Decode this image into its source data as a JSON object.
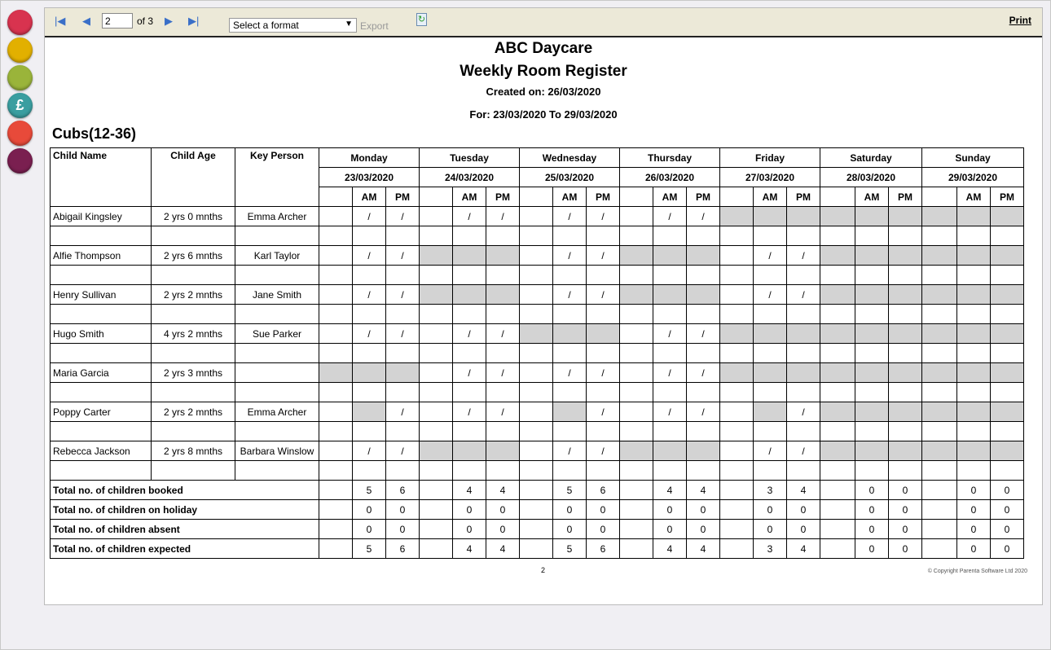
{
  "sidebar": {
    "items": [
      {
        "icon": "family-icon",
        "color": "#d8334f"
      },
      {
        "icon": "baby-icon",
        "color": "#e2b000"
      },
      {
        "icon": "register-icon",
        "color": "#9ab43a"
      },
      {
        "icon": "pound-icon",
        "color": "#3a9ea0",
        "glyph": "£"
      },
      {
        "icon": "parent-child-icon",
        "color": "#e84a3a"
      },
      {
        "icon": "wrench-icon",
        "color": "#7a1f50"
      }
    ]
  },
  "toolbar": {
    "page": "2",
    "of_label": "of 3",
    "format_placeholder": "Select a format",
    "export_label": "Export",
    "print_label": "Print"
  },
  "report": {
    "org": "ABC Daycare",
    "title": "Weekly Room Register",
    "created": "Created on: 26/03/2020",
    "range": "For: 23/03/2020 To 29/03/2020",
    "room": "Cubs(12-36)",
    "page_number": "2",
    "copyright": "© Copyright Parenta Software Ltd 2020"
  },
  "table": {
    "headers": {
      "name": "Child Name",
      "age": "Child Age",
      "key": "Key Person",
      "am": "AM",
      "pm": "PM"
    },
    "days": [
      {
        "day": "Monday",
        "date": "23/03/2020"
      },
      {
        "day": "Tuesday",
        "date": "24/03/2020"
      },
      {
        "day": "Wednesday",
        "date": "25/03/2020"
      },
      {
        "day": "Thursday",
        "date": "26/03/2020"
      },
      {
        "day": "Friday",
        "date": "27/03/2020"
      },
      {
        "day": "Saturday",
        "date": "28/03/2020"
      },
      {
        "day": "Sunday",
        "date": "29/03/2020"
      }
    ],
    "children": [
      {
        "name": "Abigail Kingsley",
        "age": "2 yrs 0 mnths",
        "key": "Emma Archer",
        "cells": [
          ".//",
          ".//",
          ".//",
          ".//",
          "ggg",
          "ggg",
          "ggg"
        ]
      },
      {
        "name": "Alfie Thompson",
        "age": "2 yrs 6 mnths",
        "key": "Karl Taylor",
        "cells": [
          ".//",
          "ggg",
          ".//",
          "ggg",
          ".//",
          "ggg",
          "ggg"
        ]
      },
      {
        "name": "Henry Sullivan",
        "age": "2 yrs 2 mnths",
        "key": "Jane Smith",
        "cells": [
          ".//",
          "ggg",
          ".//",
          "ggg",
          ".//",
          "ggg",
          "ggg"
        ]
      },
      {
        "name": "Hugo Smith",
        "age": "4 yrs 2 mnths",
        "key": "Sue Parker",
        "cells": [
          ".//",
          ".//",
          "ggg",
          ".//",
          "ggg",
          "ggg",
          "ggg"
        ]
      },
      {
        "name": "Maria Garcia",
        "age": "2 yrs 3 mnths",
        "key": "",
        "cells": [
          "ggg",
          ".//",
          ".//",
          ".//",
          "ggg",
          "ggg",
          "ggg"
        ]
      },
      {
        "name": "Poppy Carter",
        "age": "2 yrs 2 mnths",
        "key": "Emma Archer",
        "cells": [
          ".g/",
          ".//",
          ".g/",
          ".//",
          ".g/",
          "ggg",
          "ggg"
        ]
      },
      {
        "name": "Rebecca Jackson",
        "age": "2 yrs 8 mnths",
        "key": "Barbara Winslow",
        "cells": [
          ".//",
          "ggg",
          ".//",
          "ggg",
          ".//",
          "ggg",
          "ggg"
        ]
      }
    ],
    "mark": "/",
    "totals": [
      {
        "label": "Total no. of children booked",
        "values": [
          [
            5,
            6
          ],
          [
            4,
            4
          ],
          [
            5,
            6
          ],
          [
            4,
            4
          ],
          [
            3,
            4
          ],
          [
            0,
            0
          ],
          [
            0,
            0
          ]
        ]
      },
      {
        "label": "Total no. of children on holiday",
        "values": [
          [
            0,
            0
          ],
          [
            0,
            0
          ],
          [
            0,
            0
          ],
          [
            0,
            0
          ],
          [
            0,
            0
          ],
          [
            0,
            0
          ],
          [
            0,
            0
          ]
        ]
      },
      {
        "label": "Total no. of children absent",
        "values": [
          [
            0,
            0
          ],
          [
            0,
            0
          ],
          [
            0,
            0
          ],
          [
            0,
            0
          ],
          [
            0,
            0
          ],
          [
            0,
            0
          ],
          [
            0,
            0
          ]
        ]
      },
      {
        "label": "Total no. of children expected",
        "values": [
          [
            5,
            6
          ],
          [
            4,
            4
          ],
          [
            5,
            6
          ],
          [
            4,
            4
          ],
          [
            3,
            4
          ],
          [
            0,
            0
          ],
          [
            0,
            0
          ]
        ]
      }
    ]
  }
}
